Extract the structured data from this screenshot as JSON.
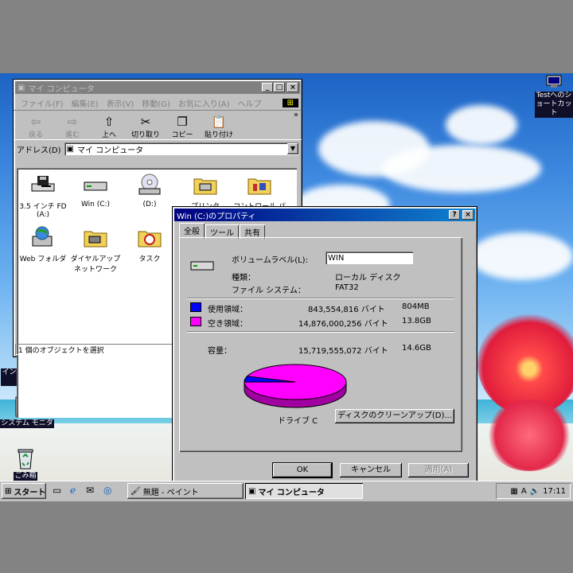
{
  "colors": {
    "title_active": "#000080",
    "title_inactive": "#808080",
    "used": "#0000ff",
    "free": "#ff00ff",
    "face": "#c0c0c0"
  },
  "desktop": {
    "icons": [
      {
        "label": "Testへのショートカット",
        "icon": "shortcut-icon"
      },
      {
        "label": "インターネットに接続",
        "icon": "internet-connect-icon"
      },
      {
        "label": "システム モニタ",
        "icon": "system-monitor-icon"
      },
      {
        "label": "ごみ箱",
        "icon": "recycle-bin-icon"
      }
    ]
  },
  "mycomputer": {
    "title": "マイ コンピュータ",
    "menu": [
      "ファイル(F)",
      "編集(E)",
      "表示(V)",
      "移動(G)",
      "お気に入り(A)",
      "ヘルプ"
    ],
    "toolbar": [
      {
        "label": "戻る",
        "icon": "back-arrow-icon",
        "disabled": true
      },
      {
        "label": "進む",
        "icon": "forward-arrow-icon",
        "disabled": true
      },
      {
        "label": "上へ",
        "icon": "up-folder-icon",
        "disabled": false
      },
      {
        "label": "切り取り",
        "icon": "scissors-icon",
        "disabled": false
      },
      {
        "label": "コピー",
        "icon": "copy-icon",
        "disabled": false
      },
      {
        "label": "貼り付け",
        "icon": "paste-icon",
        "disabled": false
      }
    ],
    "address_label": "アドレス(D)",
    "address_value": "マイ コンピュータ",
    "items": [
      {
        "label": "3.5 インチ FD (A:)",
        "icon": "floppy-drive-icon"
      },
      {
        "label": "Win (C:)",
        "icon": "hard-drive-icon"
      },
      {
        "label": "(D:)",
        "icon": "cd-drive-icon"
      },
      {
        "label": "プリンタ",
        "icon": "printers-folder-icon"
      },
      {
        "label": "コントロール パネル",
        "icon": "control-panel-icon"
      },
      {
        "label": "Web フォルダ",
        "icon": "web-folder-icon"
      },
      {
        "label": "ダイヤルアップ ネットワーク",
        "icon": "dialup-network-icon"
      },
      {
        "label": "タスク",
        "icon": "scheduled-tasks-icon"
      }
    ],
    "status": "1 個のオブジェクトを選択"
  },
  "props": {
    "title": "Win (C:)のプロパティ",
    "tabs": [
      "全般",
      "ツール",
      "共有"
    ],
    "label_caption": "ボリュームラベル(L):",
    "label_value": "WIN",
    "type_caption": "種類：",
    "type_value": "ローカル ディスク",
    "fs_caption": "ファイル システム：",
    "fs_value": "FAT32",
    "used_caption": "使用領域：",
    "used_bytes": "843,554,816 バイト",
    "used_size": "804MB",
    "free_caption": "空き領域：",
    "free_bytes": "14,876,000,256 バイト",
    "free_size": "13.8GB",
    "cap_caption": "容量：",
    "cap_bytes": "15,719,555,072 バイト",
    "cap_size": "14.6GB",
    "used_fraction": 0.0537,
    "drive_caption": "ドライブ C",
    "cleanup_button": "ディスクのクリーンアップ(D)...",
    "ok": "OK",
    "cancel": "キャンセル",
    "apply": "適用(A)"
  },
  "taskbar": {
    "start": "スタート",
    "tasks": [
      "無題 - ペイント",
      "マイ コンピュータ"
    ],
    "clock": "17:11"
  }
}
